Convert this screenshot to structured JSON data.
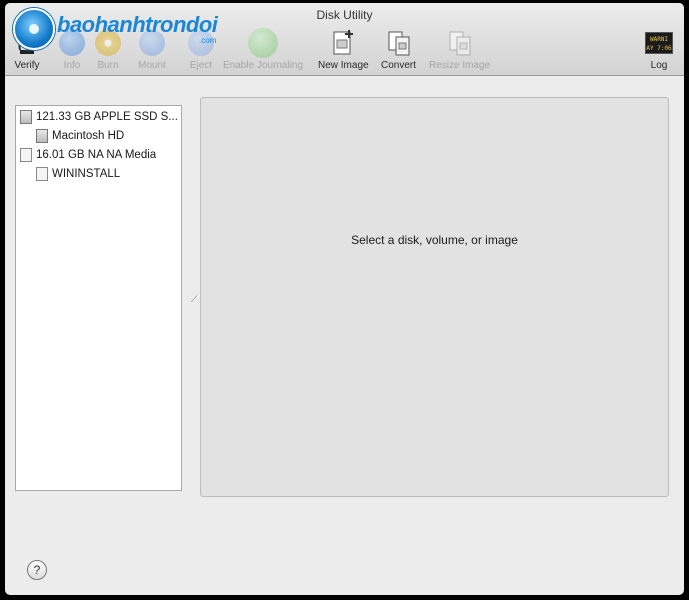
{
  "window": {
    "title": "Disk Utility"
  },
  "watermark": {
    "text": "baohanhtrondoi",
    "sub": ".com"
  },
  "toolbar": {
    "verify": "Verify",
    "info": "Info",
    "burn": "Burn",
    "mount": "Mount",
    "eject": "Eject",
    "enable_journaling": "Enable Journaling",
    "new_image": "New Image",
    "convert": "Convert",
    "resize_image": "Resize Image",
    "log": "Log",
    "log_icon_text_1": "WARNI",
    "log_icon_text_2": "AY 7:06"
  },
  "sidebar": {
    "items": [
      {
        "label": "121.33 GB APPLE SSD S..."
      },
      {
        "label": "Macintosh HD"
      },
      {
        "label": "16.01 GB NA NA Media"
      },
      {
        "label": "WININSTALL"
      }
    ]
  },
  "main": {
    "placeholder": "Select a disk, volume, or image"
  },
  "footer": {
    "help": "?"
  }
}
